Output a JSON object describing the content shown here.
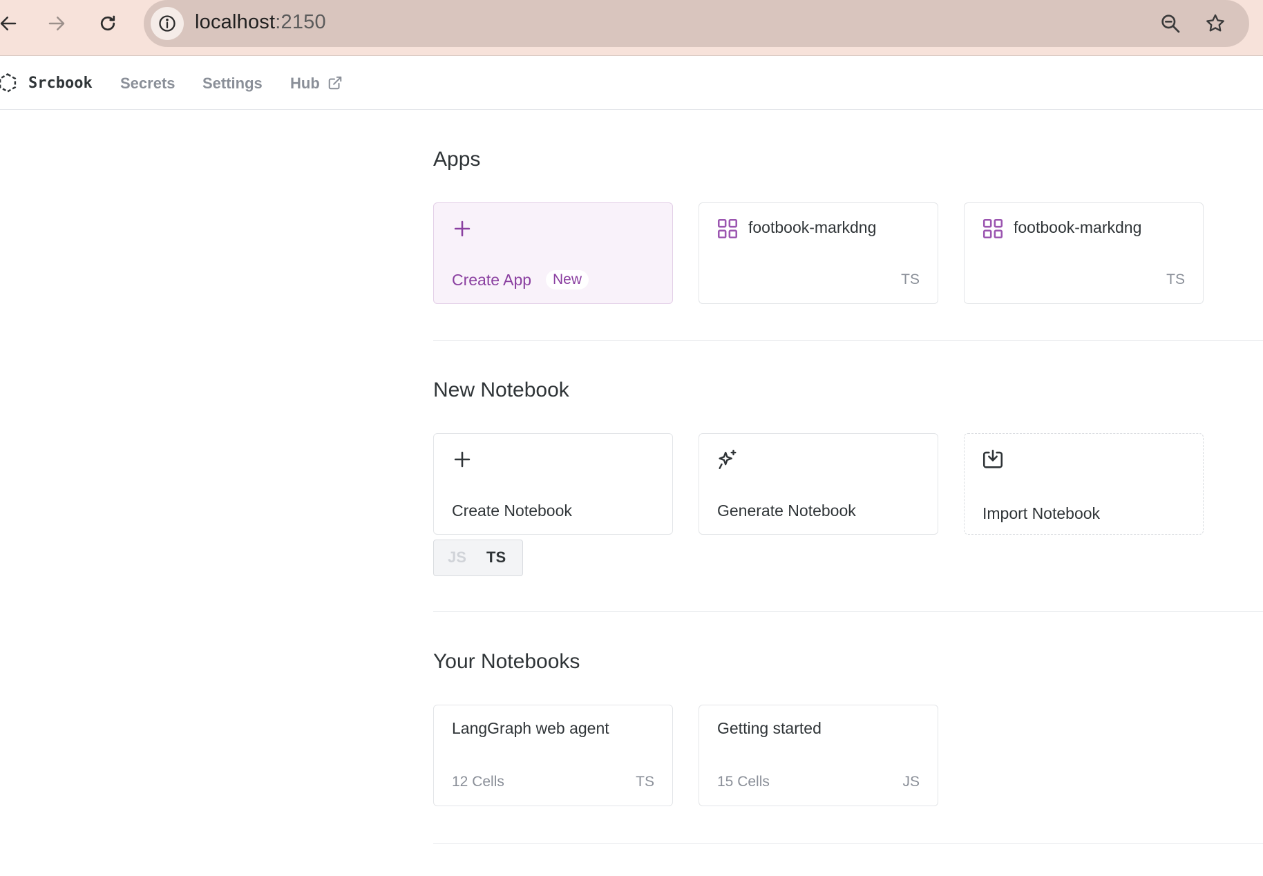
{
  "browser": {
    "url_host": "localhost",
    "url_port": ":2150"
  },
  "nav": {
    "logo": "Srcbook",
    "links": [
      "Secrets",
      "Settings",
      "Hub"
    ]
  },
  "apps": {
    "title": "Apps",
    "create_label": "Create App",
    "create_badge": "New",
    "items": [
      {
        "name": "footbook-markdng",
        "lang": "TS"
      },
      {
        "name": "footbook-markdng",
        "lang": "TS"
      }
    ]
  },
  "new_notebook": {
    "title": "New Notebook",
    "create_label": "Create Notebook",
    "generate_label": "Generate Notebook",
    "import_label": "Import Notebook",
    "lang_options": [
      "JS",
      "TS"
    ],
    "selected_lang": "TS"
  },
  "your_notebooks": {
    "title": "Your Notebooks",
    "items": [
      {
        "name": "LangGraph web agent",
        "cells": "12 Cells",
        "lang": "TS"
      },
      {
        "name": "Getting started",
        "cells": "15 Cells",
        "lang": "JS"
      }
    ]
  },
  "colors": {
    "accent": "#8a3fa0",
    "chrome": "#f7e2da",
    "omnibox": "#d9c5be"
  },
  "icons": [
    "back-arrow-icon",
    "forward-arrow-icon",
    "reload-icon",
    "info-icon",
    "zoom-icon",
    "star-icon",
    "hexagon-logo-icon",
    "external-link-icon",
    "plus-icon",
    "grid-icon",
    "sparkles-icon",
    "import-icon"
  ]
}
